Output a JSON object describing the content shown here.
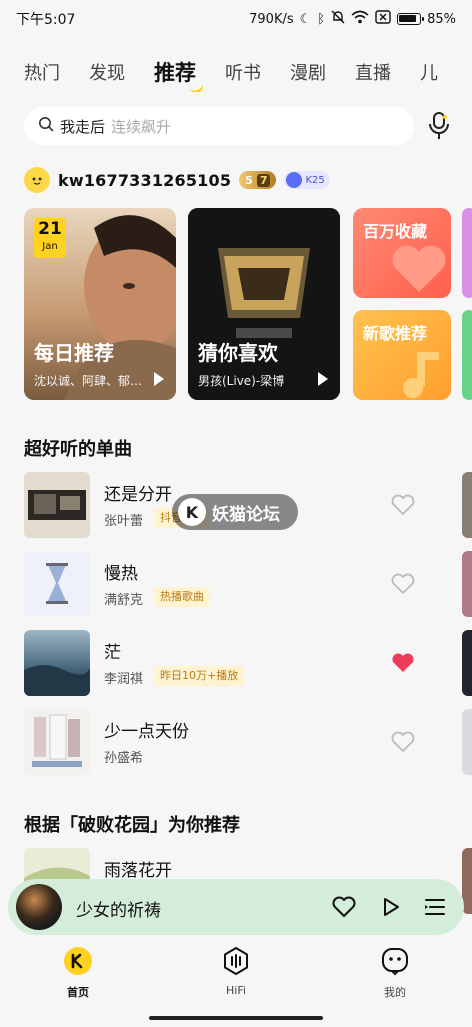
{
  "status_bar": {
    "time": "下午5:07",
    "net_speed": "790K/s",
    "battery": "85%"
  },
  "tabs": [
    {
      "label": "热门",
      "active": false
    },
    {
      "label": "发现",
      "active": false
    },
    {
      "label": "推荐",
      "active": true
    },
    {
      "label": "听书",
      "active": false
    },
    {
      "label": "漫剧",
      "active": false
    },
    {
      "label": "直播",
      "active": false
    },
    {
      "label": "儿",
      "active": false
    }
  ],
  "search": {
    "keyword": "我走后",
    "hint": "连续飙升"
  },
  "user": {
    "name": "kw1677331265105",
    "level_badge": "5",
    "level_badge_sub": "7",
    "k_badge": "K25"
  },
  "cards": {
    "daily": {
      "title": "每日推荐",
      "subtitle": "沈以诚、阿肆、郁…",
      "date_day": "21",
      "date_month": "Jan"
    },
    "guess": {
      "title": "猜你喜欢",
      "subtitle": "男孩(Live)-梁博"
    },
    "million": {
      "title": "百万收藏"
    },
    "new_songs": {
      "title": "新歌推荐"
    }
  },
  "section_single": {
    "title": "超好听的单曲"
  },
  "songs": [
    {
      "title": "还是分开",
      "artist": "张叶蕾",
      "tag": "抖音热歌",
      "liked": false
    },
    {
      "title": "慢热",
      "artist": "满舒克",
      "tag": "热播歌曲",
      "liked": false
    },
    {
      "title": "茫",
      "artist": "李润祺",
      "tag": "昨日10万+播放",
      "liked": true
    },
    {
      "title": "少一点天份",
      "artist": "孙盛希",
      "tag": "",
      "liked": false
    }
  ],
  "section_based": {
    "title": "根据「破败花园」为你推荐",
    "first_song": "雨落花开"
  },
  "watermark": {
    "text": "妖猫论坛"
  },
  "player": {
    "title": "少女的祈祷"
  },
  "nav": [
    {
      "label": "首页",
      "active": true
    },
    {
      "label": "HiFi",
      "active": false
    },
    {
      "label": "我的",
      "active": false
    }
  ],
  "colors": {
    "accent": "#ffd21f",
    "liked_heart": "#ef3b5a",
    "player_bg": "#d4ecda"
  }
}
